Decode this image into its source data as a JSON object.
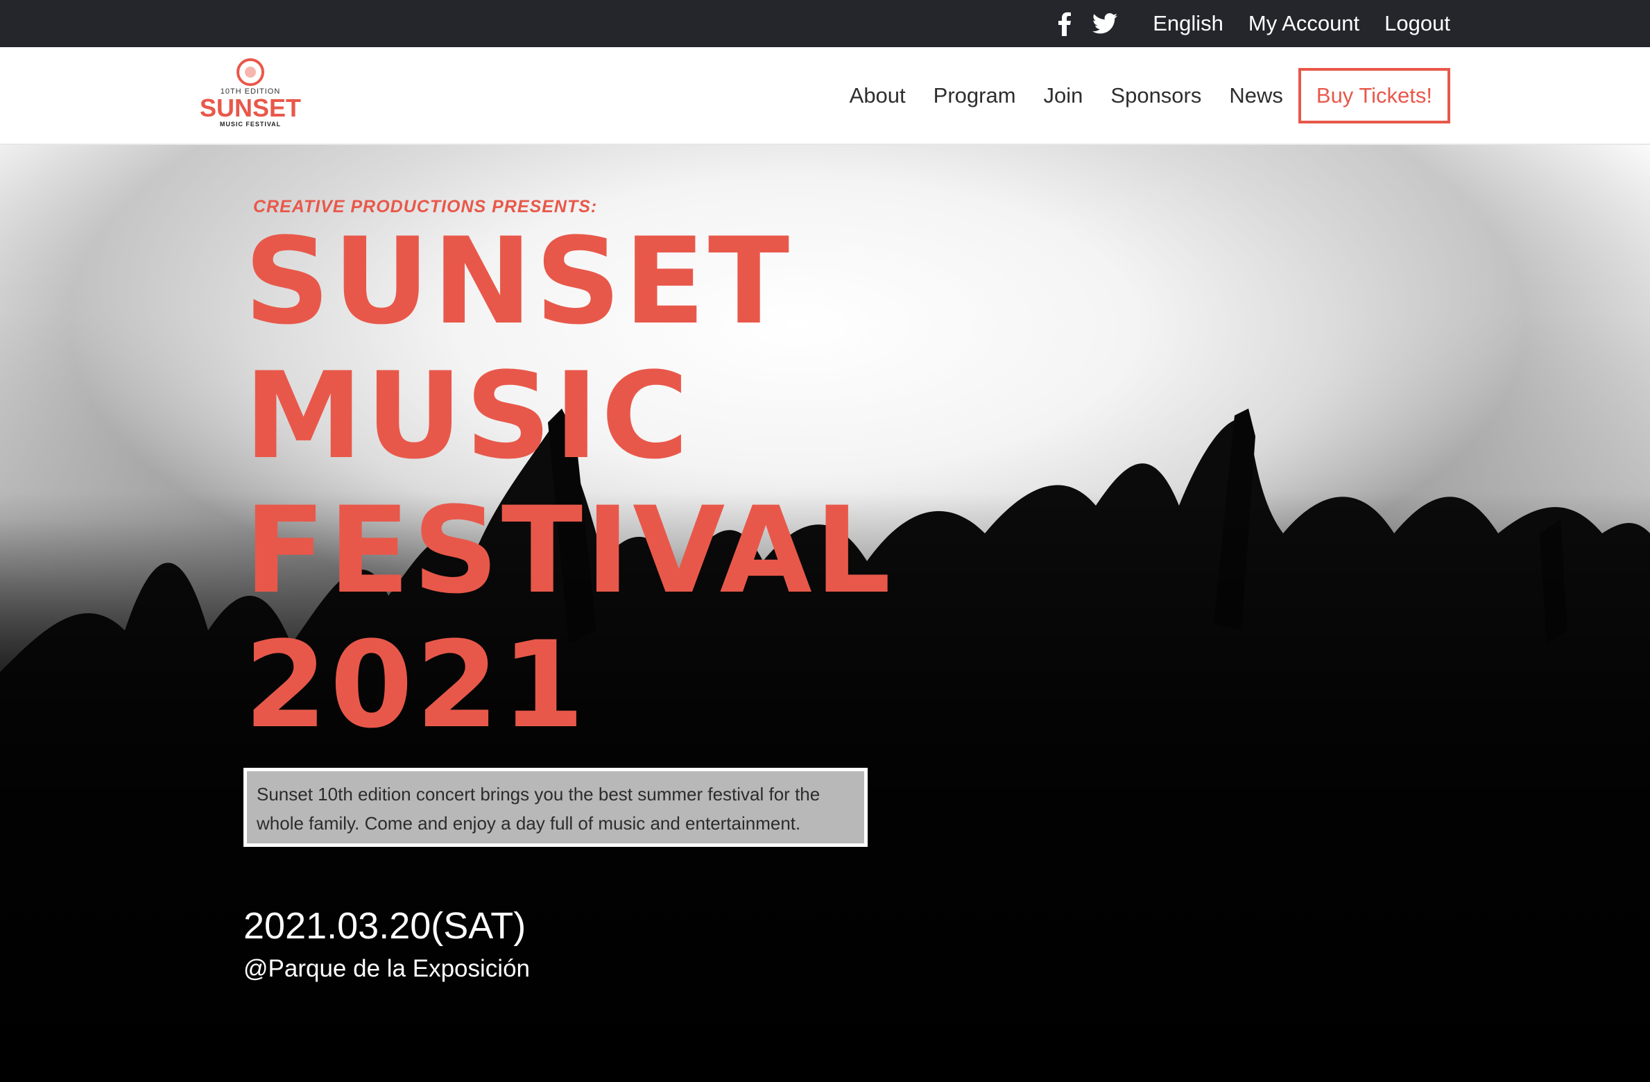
{
  "topbar": {
    "icons": [
      "facebook-icon",
      "twitter-icon"
    ],
    "language": "English",
    "account": "My Account",
    "logout": "Logout"
  },
  "logo": {
    "edition": "10TH EDITION",
    "word": "SUNSET",
    "sub": "MUSIC FESTIVAL"
  },
  "nav": {
    "items": [
      "About",
      "Program",
      "Join",
      "Sponsors",
      "News"
    ],
    "buy": "Buy Tickets!"
  },
  "hero": {
    "presents": "CREATIVE PRODUCTIONS PRESENTS:",
    "title_lines": [
      "SUNSET",
      "MUSIC",
      "FESTIVAL",
      "2021"
    ],
    "description": "Sunset 10th edition concert brings you the best summer festival for the whole family. Come and enjoy a day full of music and entertainment.",
    "date": "2021.03.20(SAT)",
    "venue": "@Parque de la Exposición"
  },
  "colors": {
    "accent": "#e8584a",
    "topbar_bg": "#24262c"
  }
}
